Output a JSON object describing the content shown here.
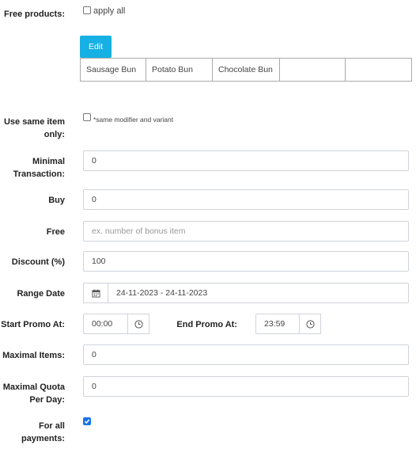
{
  "free_products": {
    "label": "Free products:",
    "apply_all_label": "apply all",
    "apply_all_checked": false,
    "edit_button": "Edit",
    "products": [
      "Sausage Bun",
      "Potato Bun",
      "Chocolate Bun",
      "",
      ""
    ]
  },
  "use_same_item": {
    "label_line1": "Use same item",
    "label_line2": "only:",
    "note": "*same modifier and variant",
    "checked": false
  },
  "minimal_transaction": {
    "label_line1": "Minimal",
    "label_line2": "Transaction:",
    "value": "0"
  },
  "buy": {
    "label": "Buy",
    "value": "0"
  },
  "free": {
    "label": "Free",
    "placeholder": "ex. number of bonus item"
  },
  "discount": {
    "label": "Discount (%)",
    "value": "100"
  },
  "range_date": {
    "label": "Range Date",
    "value": "24-11-2023 - 24-11-2023",
    "icon": "calendar-icon"
  },
  "start_promo": {
    "label": "Start Promo At:",
    "value": "00:00",
    "icon": "clock-icon"
  },
  "end_promo": {
    "label": "End Promo At:",
    "value": "23:59",
    "icon": "clock-icon"
  },
  "maximal_items": {
    "label": "Maximal Items:",
    "value": "0"
  },
  "maximal_quota": {
    "label_line1": "Maximal Quota",
    "label_line2": "Per Day:",
    "value": "0"
  },
  "for_all_payments": {
    "label_line1": "For all",
    "label_line2": "payments:",
    "checked": true
  },
  "colors": {
    "accent": "#17b0e5",
    "checkbox_checked": "#1a73e8",
    "border": "#cfd4da"
  }
}
